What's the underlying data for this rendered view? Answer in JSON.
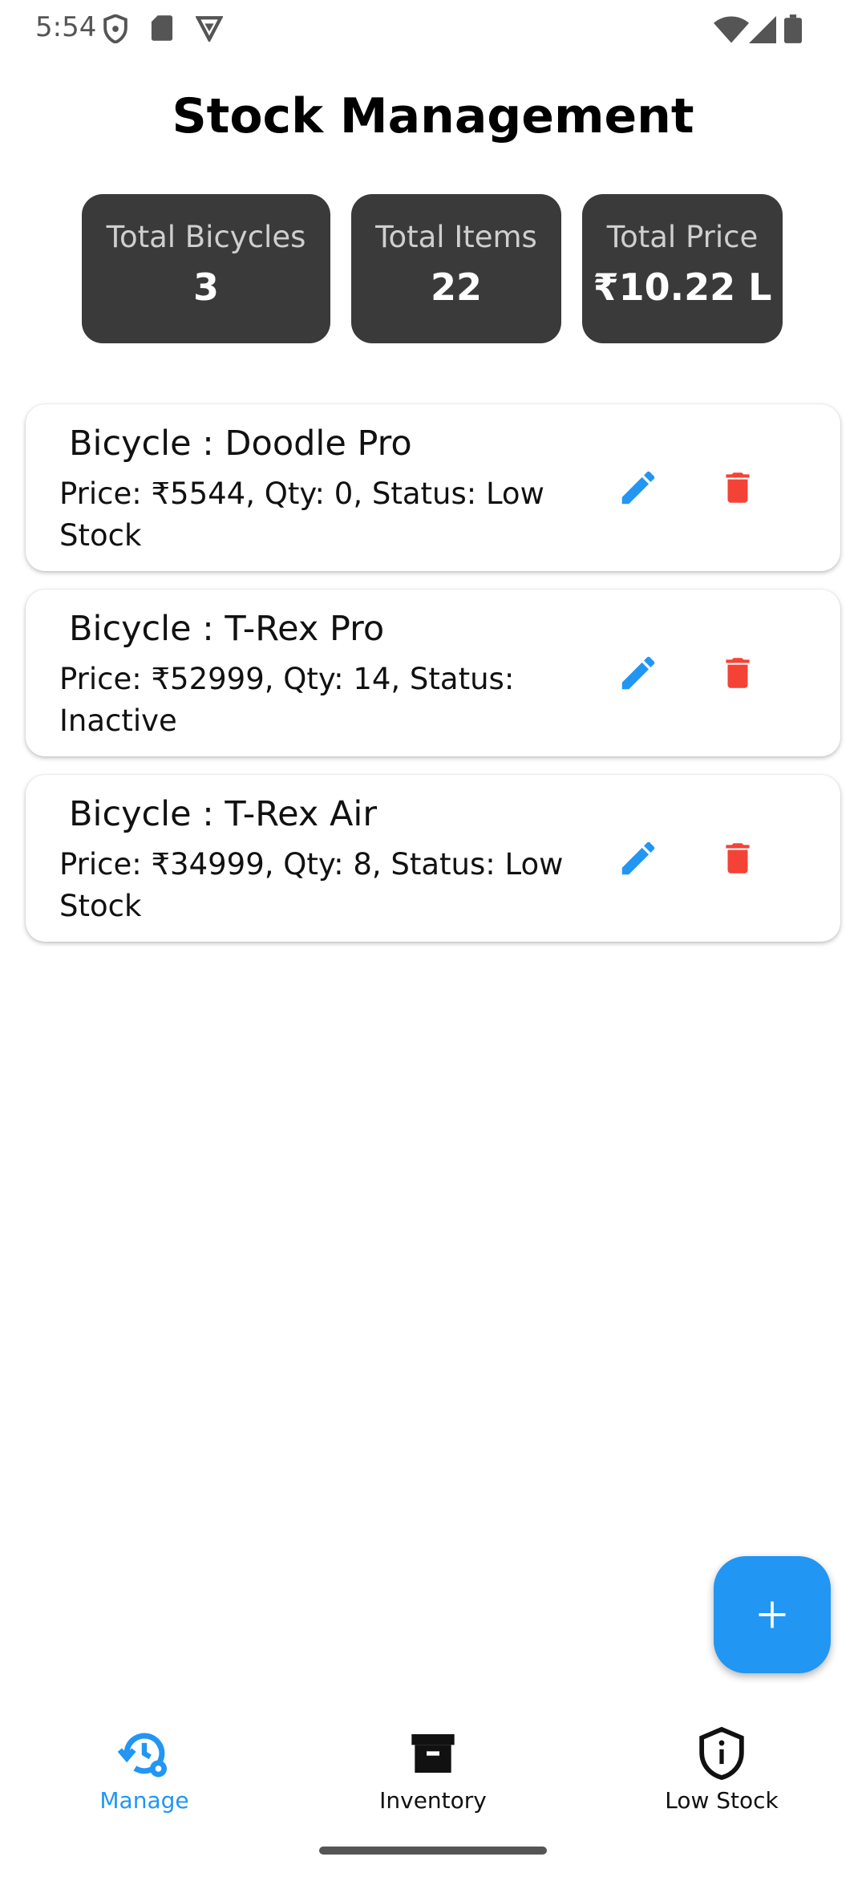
{
  "status_bar": {
    "time": "5:54",
    "icons": [
      "shield-icon",
      "sd-card-icon",
      "vpn-icon",
      "wifi-icon",
      "signal-icon",
      "battery-icon"
    ]
  },
  "title": "Stock Management",
  "stats": [
    {
      "label": "Total Bicycles",
      "value": "3"
    },
    {
      "label": "Total Items",
      "value": "22"
    },
    {
      "label": "Total Price",
      "value": "₹10.22 L"
    }
  ],
  "items": [
    {
      "title": "Bicycle : Doodle Pro",
      "subtitle": "Price: ₹5544, Qty: 0, Status: Low Stock"
    },
    {
      "title": "Bicycle : T-Rex Pro",
      "subtitle": "Price: ₹52999, Qty: 14, Status: Inactive"
    },
    {
      "title": "Bicycle : T-Rex Air",
      "subtitle": "Price: ₹34999, Qty: 8, Status: Low Stock"
    }
  ],
  "actions": {
    "edit_icon": "pencil-icon",
    "delete_icon": "trash-icon"
  },
  "fab": {
    "icon": "plus-icon"
  },
  "nav": [
    {
      "label": "Manage",
      "icon": "manage-history-icon",
      "active": true
    },
    {
      "label": "Inventory",
      "icon": "archive-icon",
      "active": false
    },
    {
      "label": "Low Stock",
      "icon": "shield-alert-icon",
      "active": false
    }
  ],
  "colors": {
    "accent": "#2196f3",
    "danger": "#f44336",
    "stat_card": "#3a3a3a",
    "text": "#111111"
  }
}
